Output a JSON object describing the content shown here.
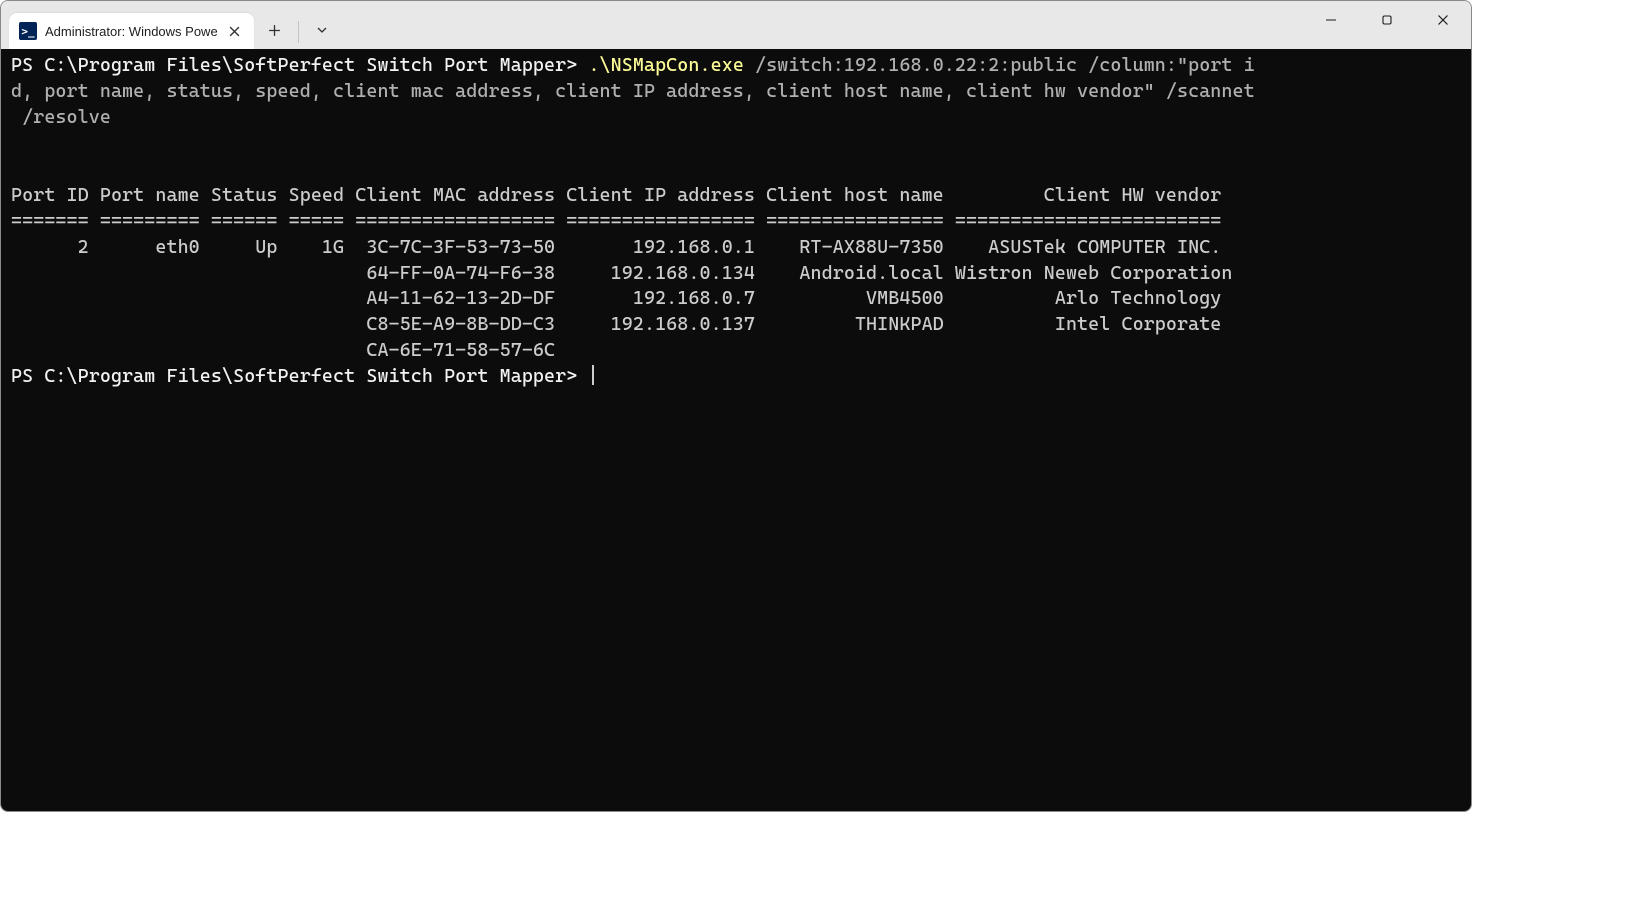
{
  "tab": {
    "title": "Administrator: Windows Powe"
  },
  "prompt1": "PS C:\\Program Files\\SoftPerfect Switch Port Mapper> ",
  "exe": ".\\NSMapCon.exe",
  "cmd_line1_rest": " /switch:192.168.0.22:2:public /column:\"port i",
  "cmd_line2": "d, port name, status, speed, client mac address, client IP address, client host name, client hw vendor\" /scannet",
  "cmd_line3": " /resolve",
  "header": "Port ID Port name Status Speed Client MAC address Client IP address Client host name         Client HW vendor",
  "sep": "======= ========= ====== ===== ================== ================= ================ ========================",
  "rows": [
    "      2      eth0     Up    1G  3C-7C-3F-53-73-50       192.168.0.1    RT-AX88U-7350    ASUSTek COMPUTER INC.",
    "                                64-FF-0A-74-F6-38     192.168.0.134    Android.local Wistron Neweb Corporation",
    "                                A4-11-62-13-2D-DF       192.168.0.7          VMB4500          Arlo Technology",
    "                                C8-5E-A9-8B-DD-C3     192.168.0.137         THINKPAD          Intel Corporate",
    "                                CA-6E-71-58-57-6C"
  ],
  "prompt2": "PS C:\\Program Files\\SoftPerfect Switch Port Mapper> "
}
